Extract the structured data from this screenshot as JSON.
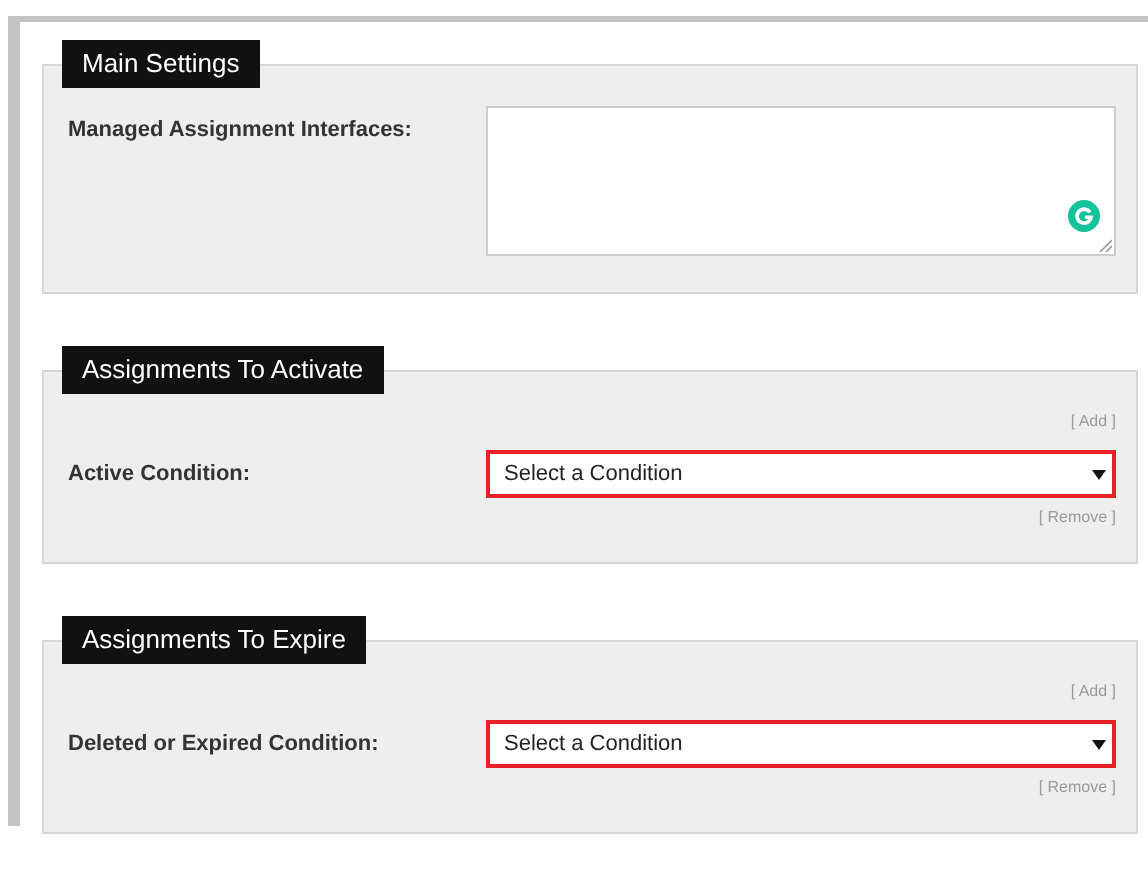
{
  "sections": [
    {
      "title": "Main Settings",
      "rows": [
        {
          "label": "Managed Assignment Interfaces:",
          "field": {
            "kind": "textarea"
          }
        }
      ]
    },
    {
      "title": "Assignments To Activate",
      "add_link": "[ Add ]",
      "rows": [
        {
          "label": "Active Condition:",
          "field": {
            "kind": "select",
            "value": "Select a Condition",
            "invalid": true
          },
          "remove_link": "[ Remove ]"
        }
      ]
    },
    {
      "title": "Assignments To Expire",
      "add_link": "[ Add ]",
      "rows": [
        {
          "label": "Deleted or Expired Condition:",
          "field": {
            "kind": "select",
            "value": "Select a Condition",
            "invalid": true
          },
          "remove_link": "[ Remove ]"
        }
      ]
    }
  ]
}
